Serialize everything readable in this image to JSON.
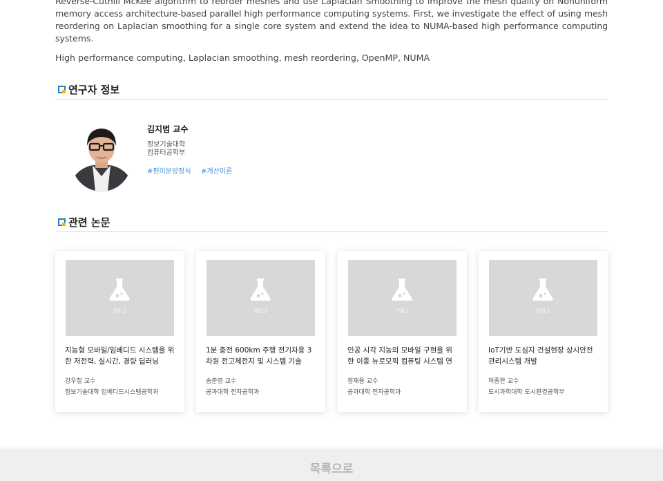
{
  "abstract": {
    "text": "Reverse-Cuthill McKee algorithm to reorder meshes and use Laplacian Smoothing to improve the mesh quality on Nonuniform memory access architecture-based parallel high performance computing systems. First, we investigate the effect of using mesh reordering on Laplacian smoothing for a single core system and extend the idea to NUMA-based high performance computing systems.",
    "keywords": "High performance computing, Laplacian smoothing, mesh reordering, OpenMP, NUMA"
  },
  "researcher_section": {
    "title": "연구자 정보",
    "name": "김지범 교수",
    "college": "정보기술대학",
    "department": "컴퓨터공학부",
    "tags": [
      "#편미분방정식",
      "#계산이론"
    ]
  },
  "papers_section": {
    "title": "관련 논문",
    "cards": [
      {
        "title": "지능형 모바일/임베디드 시스템을 위한 저전력, 실시간, 경량 딥러닝",
        "professor": "강우철 교수",
        "department": "정보기술대학 임베디드시스템공학과"
      },
      {
        "title": "1분 충전 600km 주행 전기차용 3차원 전고체전지 및 시스템 기술",
        "professor": "송준영 교수",
        "department": "공과대학 전자공학과"
      },
      {
        "title": "인공 시각 지능의 모바일 구현을 위한 이종 뉴로모픽 컴퓨팅 시스템 연",
        "professor": "정재용 교수",
        "department": "공과대학 전자공학과"
      },
      {
        "title": "IoT기반 도심지 건설현장 상시안전관리시스템 개발",
        "professor": "허종완 교수",
        "department": "도시과학대학 도시환경공학부"
      }
    ],
    "placeholder_icon": "flask-icon",
    "placeholder_caption": "INU"
  },
  "footer": {
    "list_button": "목록으로"
  },
  "colors": {
    "accent_blue": "#1a7fc8",
    "accent_yellow": "#f5b70f",
    "tag_blue": "#4a90d9",
    "thumb_gray": "#d8d8d8"
  }
}
